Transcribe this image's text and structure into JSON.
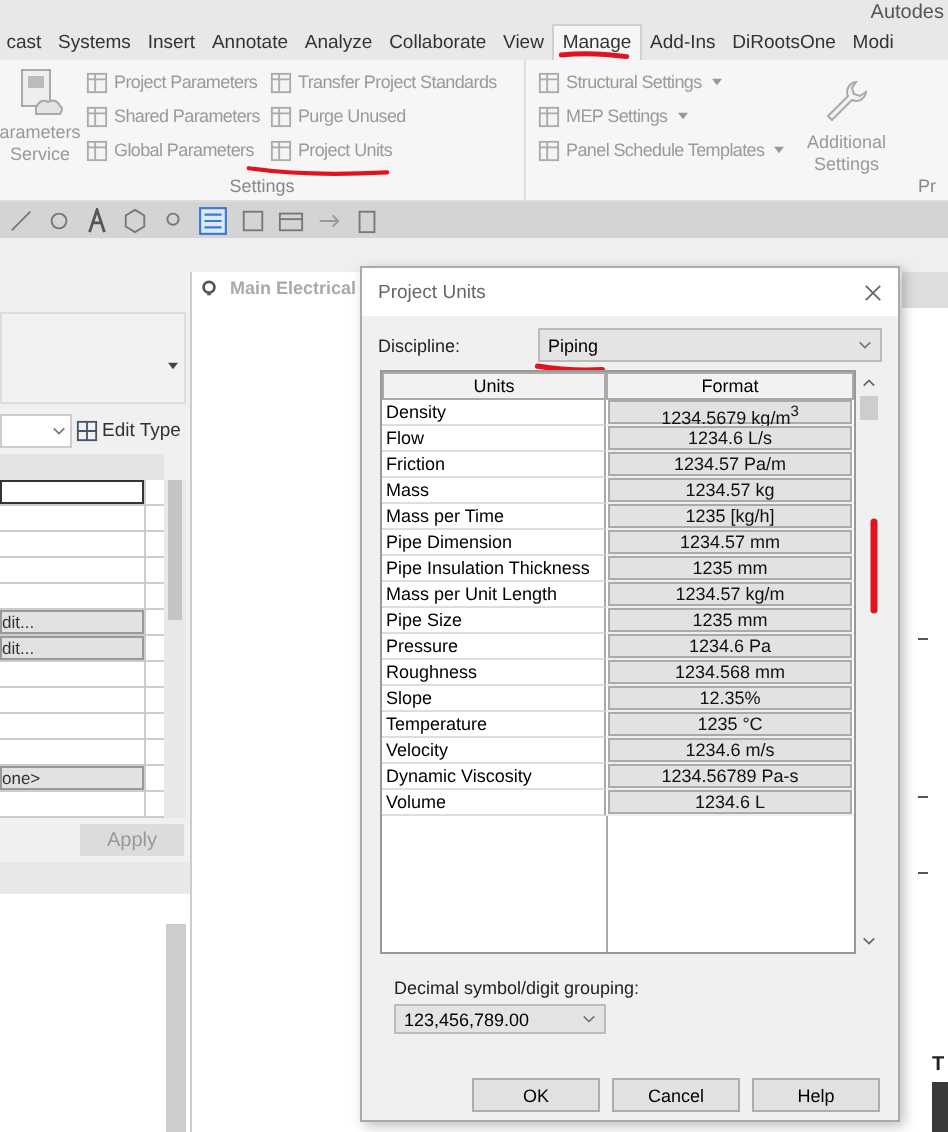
{
  "app_title": "Autodes",
  "ribbon_tabs": [
    {
      "label": "cast",
      "selected": false,
      "marked": false
    },
    {
      "label": "Systems",
      "selected": false,
      "marked": false
    },
    {
      "label": "Insert",
      "selected": false,
      "marked": false
    },
    {
      "label": "Annotate",
      "selected": false,
      "marked": false
    },
    {
      "label": "Analyze",
      "selected": false,
      "marked": false
    },
    {
      "label": "Collaborate",
      "selected": false,
      "marked": false
    },
    {
      "label": "View",
      "selected": false,
      "marked": false
    },
    {
      "label": "Manage",
      "selected": true,
      "marked": true
    },
    {
      "label": "Add-Ins",
      "selected": false,
      "marked": false
    },
    {
      "label": "DiRootsOne",
      "selected": false,
      "marked": false
    },
    {
      "label": "Modi",
      "selected": false,
      "marked": false
    }
  ],
  "settings_panel": {
    "label": "Settings",
    "large_button": [
      "arameters",
      "Service"
    ],
    "columns": [
      [
        {
          "label": "Project Parameters",
          "marked": false
        },
        {
          "label": "Shared Parameters",
          "marked": false
        },
        {
          "label": "Global Parameters",
          "marked": false
        }
      ],
      [
        {
          "label": "Transfer Project Standards",
          "marked": false
        },
        {
          "label": "Purge Unused",
          "marked": false
        },
        {
          "label": "Project Units",
          "marked": true
        }
      ]
    ]
  },
  "mep_panel": {
    "items": [
      {
        "label": "Structural Settings"
      },
      {
        "label": "MEP Settings"
      },
      {
        "label": "Panel Schedule Templates"
      }
    ],
    "large_button": [
      "Additional",
      "Settings"
    ]
  },
  "next_panel_label": "Pr",
  "properties": {
    "edit_type": "Edit Type",
    "rows": [
      {
        "kind": "field"
      },
      {
        "kind": "blank"
      },
      {
        "kind": "blank"
      },
      {
        "kind": "blank"
      },
      {
        "kind": "blank"
      },
      {
        "kind": "button",
        "text": "dit..."
      },
      {
        "kind": "button",
        "text": "dit..."
      },
      {
        "kind": "blank"
      },
      {
        "kind": "blank"
      },
      {
        "kind": "blank"
      },
      {
        "kind": "blank"
      },
      {
        "kind": "button",
        "text": "one>"
      },
      {
        "kind": "blank"
      }
    ],
    "apply": {
      "label": "Apply",
      "disabled": true
    }
  },
  "view_tab": "Main Electrical",
  "dialog": {
    "title": "Project Units",
    "discipline_label": "Discipline:",
    "discipline": {
      "value": "Piping",
      "marked": true
    },
    "columns": [
      "Units",
      "Format"
    ],
    "rows": [
      {
        "unit": "Density",
        "format": "1234.5679 kg/m$^{3}$"
      },
      {
        "unit": "Flow",
        "format": "1234.6 L/s"
      },
      {
        "unit": "Friction",
        "format": "1234.57 Pa/m"
      },
      {
        "unit": "Mass",
        "format": "1234.57 kg"
      },
      {
        "unit": "Mass per Time",
        "format": "1235 [kg/h]"
      },
      {
        "unit": "Pipe Dimension",
        "format": "1234.57 mm"
      },
      {
        "unit": "Pipe Insulation Thickness",
        "format": "1235 mm"
      },
      {
        "unit": "Mass per Unit Length",
        "format": "1234.57 kg/m"
      },
      {
        "unit": "Pipe Size",
        "format": "1235 mm"
      },
      {
        "unit": "Pressure",
        "format": "1234.6 Pa"
      },
      {
        "unit": "Roughness",
        "format": "1234.568 mm"
      },
      {
        "unit": "Slope",
        "format": "12.35%"
      },
      {
        "unit": "Temperature",
        "format": "1235 °C"
      },
      {
        "unit": "Velocity",
        "format": "1234.6 m/s"
      },
      {
        "unit": "Dynamic Viscosity",
        "format": "1234.56789 Pa-s"
      },
      {
        "unit": "Volume",
        "format": "1234.6 L"
      }
    ],
    "grouping_label": "Decimal symbol/digit grouping:",
    "grouping": "123,456,789.00",
    "buttons": [
      "OK",
      "Cancel",
      "Help"
    ]
  },
  "right_edge_label": "T"
}
